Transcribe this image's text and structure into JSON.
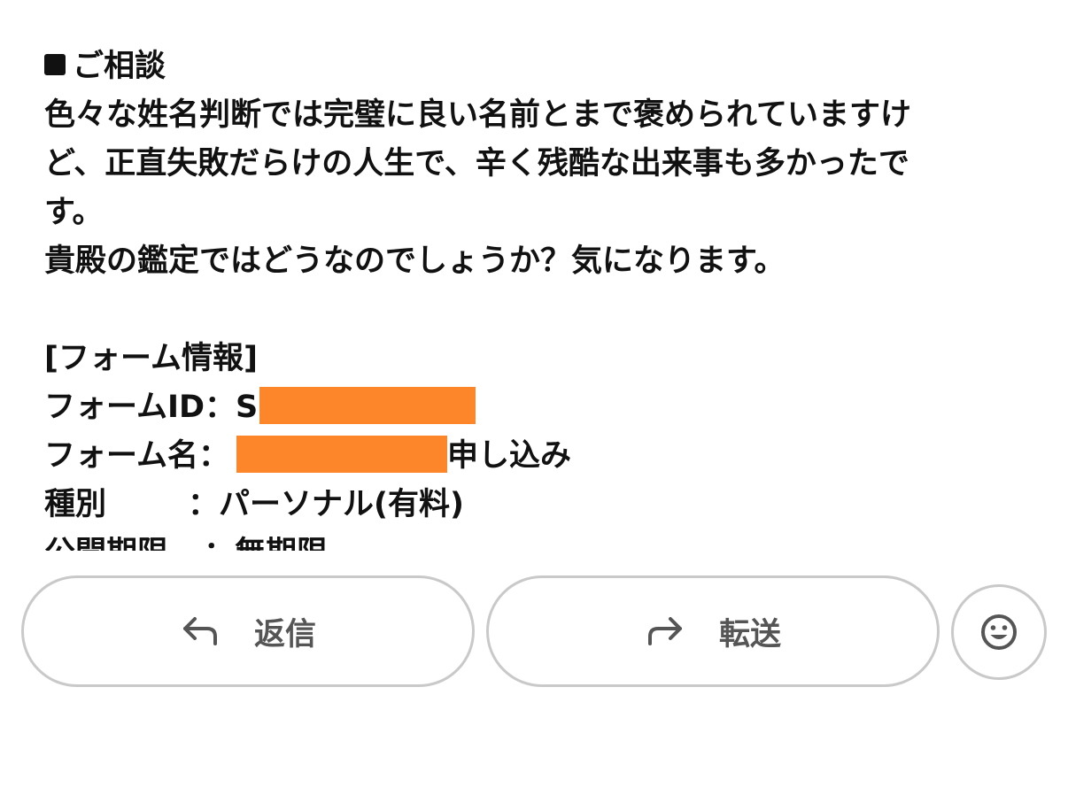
{
  "message": {
    "heading": "ご相談",
    "paragraph_lines": [
      "色々な姓名判断では完璧に良い名前とまで褒められていますけ",
      "ど、正直失敗だらけの人生で、辛く残酷な出来事も多かったで",
      "す。",
      "貴殿の鑑定ではどうなのでしょうか？気になります。"
    ],
    "form_section_title": "[フォーム情報]",
    "form_id_label": "フォームID：S",
    "form_name_label": "フォーム名：",
    "form_name_suffix": "申し込み",
    "type_label": "種別",
    "type_value": "：パーソナル(有料)",
    "period_label": "公開期限",
    "period_value": "：無期限"
  },
  "actions": {
    "reply_label": "返信",
    "forward_label": "転送"
  },
  "colors": {
    "redaction": "#fd852a",
    "button_border": "#c9c9c9",
    "button_text": "#555555"
  },
  "icons": {
    "reply": "reply-arrow-icon",
    "forward": "forward-arrow-icon",
    "emoji": "smiley-face-icon",
    "heading_bullet": "black-square-icon"
  }
}
